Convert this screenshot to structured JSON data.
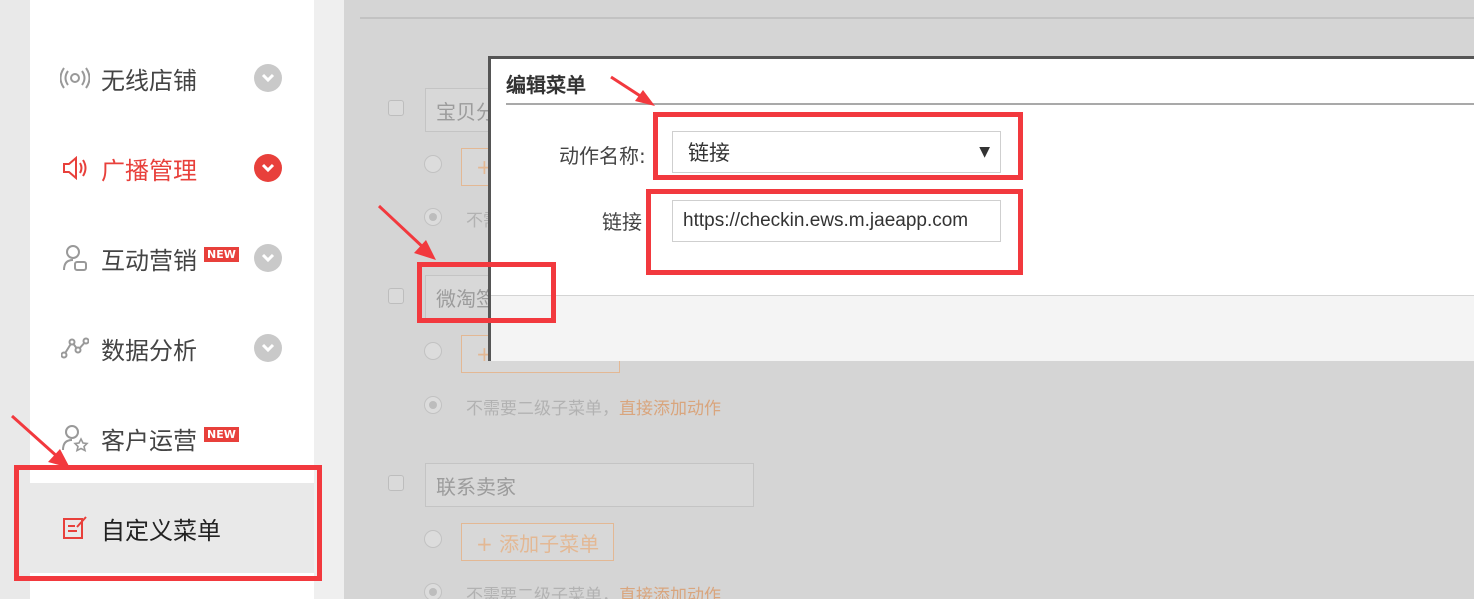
{
  "sidebar": {
    "items": [
      {
        "label": "无线店铺",
        "icon": "wireless-icon"
      },
      {
        "label": "广播管理",
        "icon": "speaker-icon"
      },
      {
        "label": "互动营销",
        "icon": "user-interaction-icon",
        "badge": "NEW"
      },
      {
        "label": "数据分析",
        "icon": "data-analysis-icon"
      },
      {
        "label": "客户运营",
        "icon": "user-star-icon",
        "badge": "NEW"
      },
      {
        "label": "自定义菜单",
        "icon": "edit-menu-icon"
      }
    ]
  },
  "background_menu": {
    "groups": [
      {
        "name": "宝贝分",
        "add_sub_label": "+"
      },
      {
        "name": "微淘签",
        "add_sub_label": "+",
        "no_sub_hint": "不需要二级子菜单，",
        "direct_action_link": "直接添加动作"
      },
      {
        "name": "联系卖家",
        "add_sub_label": "+ 添加子菜单",
        "no_sub_hint": "不需要二级子菜单，",
        "direct_action_link": "直接添加动作"
      }
    ],
    "partial_hint": "不需"
  },
  "dialog": {
    "title": "编辑菜单",
    "action_name_label": "动作名称:",
    "action_name_value": "链接",
    "link_label": "链接",
    "link_value": "https://checkin.ews.m.jaeapp.com"
  },
  "colors": {
    "accent_red": "#e8403b",
    "highlight_red": "#f2393e"
  }
}
